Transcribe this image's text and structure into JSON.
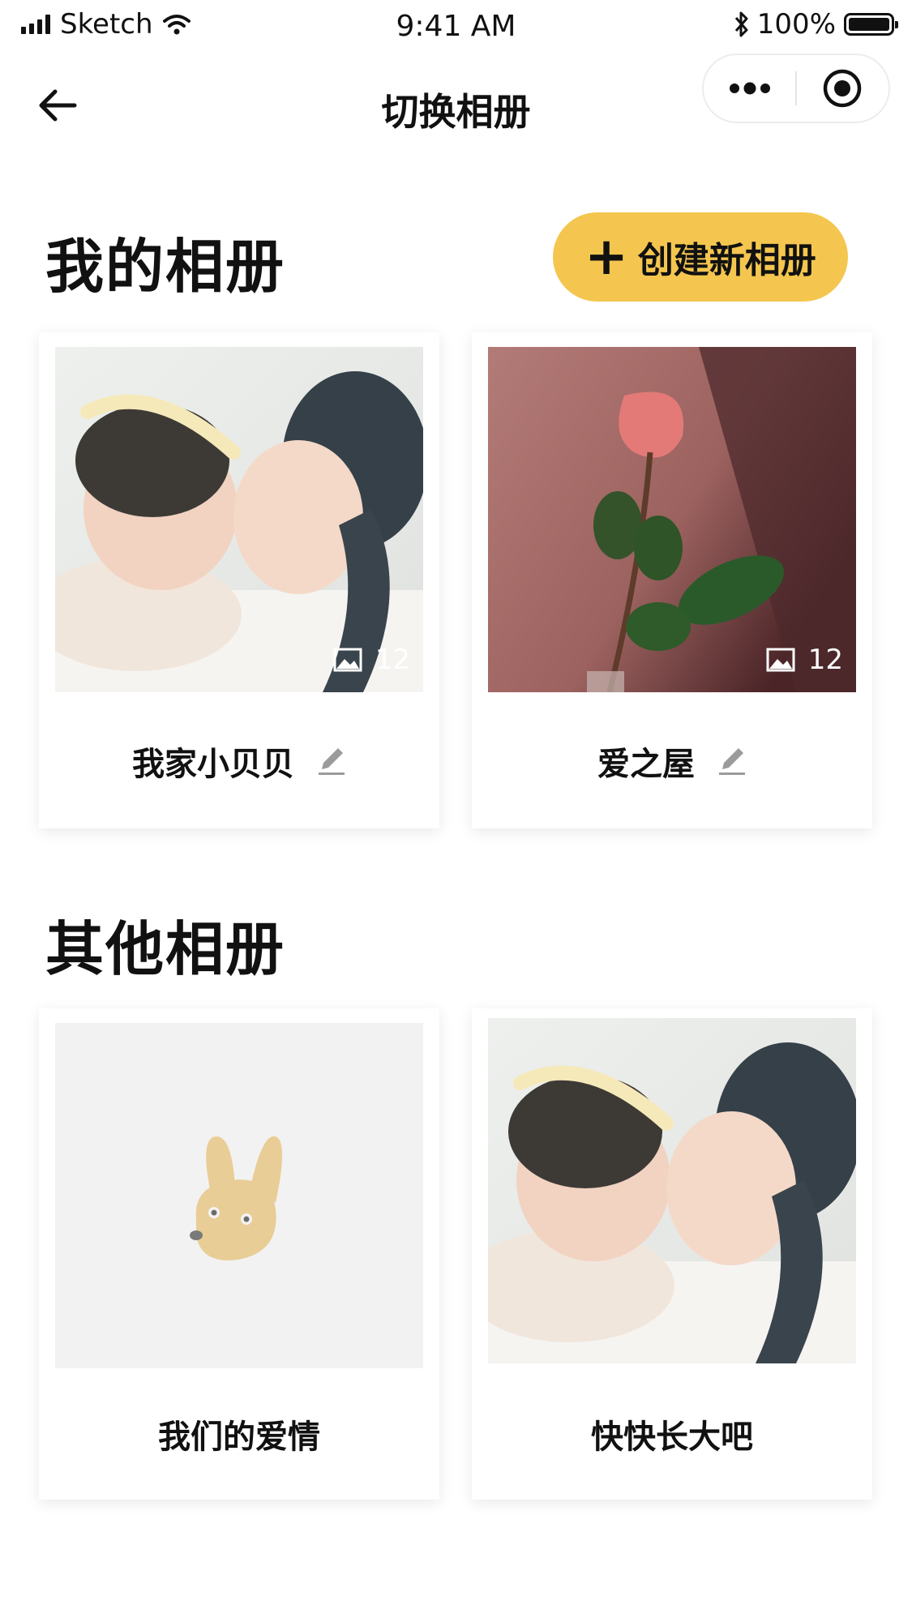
{
  "status_bar": {
    "carrier": "Sketch",
    "time": "9:41 AM",
    "battery": "100%"
  },
  "nav": {
    "title": "切换相册"
  },
  "my_albums": {
    "title": "我的相册",
    "create_label": "创建新相册",
    "items": [
      {
        "name": "我家小贝贝",
        "count": "12",
        "thumb": "baby-and-girl-photo"
      },
      {
        "name": "爱之屋",
        "count": "12",
        "thumb": "rose-photo"
      }
    ]
  },
  "other_albums": {
    "title": "其他相册",
    "items": [
      {
        "name": "我们的爱情",
        "thumb": "placeholder-rabbit"
      },
      {
        "name": "快快长大吧",
        "thumb": "baby-and-girl-photo"
      }
    ]
  },
  "colors": {
    "accent": "#f4c64f",
    "placeholder_bg": "#f2f2f2",
    "rabbit": "#e9cd96"
  }
}
